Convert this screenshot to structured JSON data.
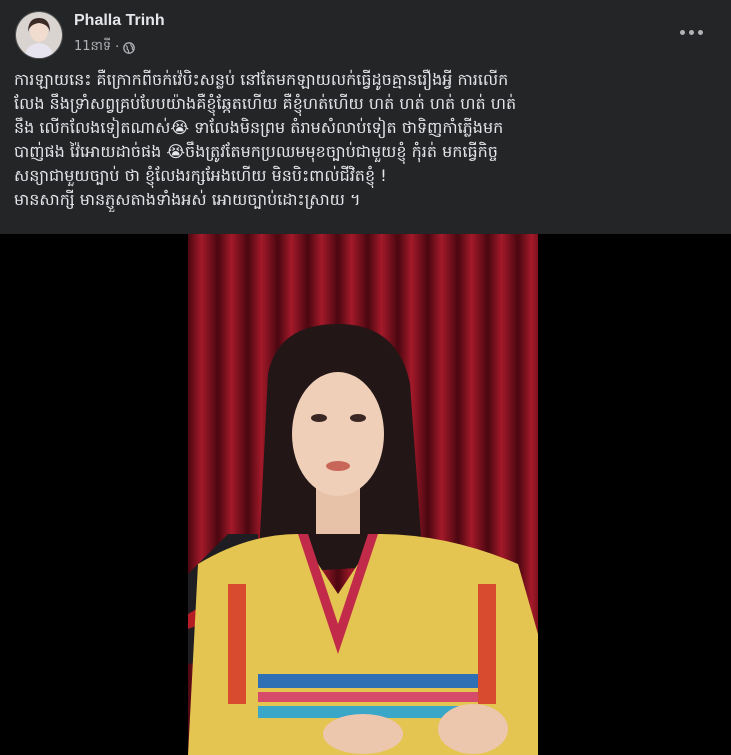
{
  "post": {
    "author": "Phalla Trinh",
    "timestamp": "11នាទី",
    "separator": "·",
    "privacy_icon": "globe-icon",
    "menu_icon": "more-horizontal-icon",
    "text_lines": [
      "ការឡាយនេះ គឺក្រោកពីចក់វ៉េបិះសន្លប់ នៅតែមកឡាយលក់ធ្វើដូចគ្មានរឿងអ្វី ការលើក",
      "លែង នឹងទ្រាំសព្វគ្រប់បែបយ៉ាងគឺខ្ញុំឆ្កែតហើយ  គឺខ្ញុំហត់ហើយ ហត់ ហត់ ហត់ ហត់ ហត់",
      "នឹង លើកលែងទៀតណាស់😭 ទាលែងមិនព្រម តំរាមសំលាប់ទៀត ថាទិញកាំភ្លើងមក",
      "បាញ់ផង វ៉ៃអោយដាច់ផង 😭ចឹងត្រូវតែមកប្រឈមមុខច្បាប់ជាមួយខ្ញុំ កុំរត់ មកធ្វើកិច្ច",
      "សន្យាជាមួយច្បាប់ ថា ខ្ញុំលែងរក្សអែងហើយ មិនបិះពាល់ជីវិតខ្ញុំ !",
      "មានសាក្សី មានភ្ញួសតាងទាំងអស់ អោយច្បាប់ដោះស្រាយ ។"
    ]
  },
  "colors": {
    "page_bg": "#242526",
    "text": "#e4e6eb",
    "secondary_text": "#b0b3b8",
    "media_bg": "#000000",
    "curtain": "#7a0f1a"
  }
}
